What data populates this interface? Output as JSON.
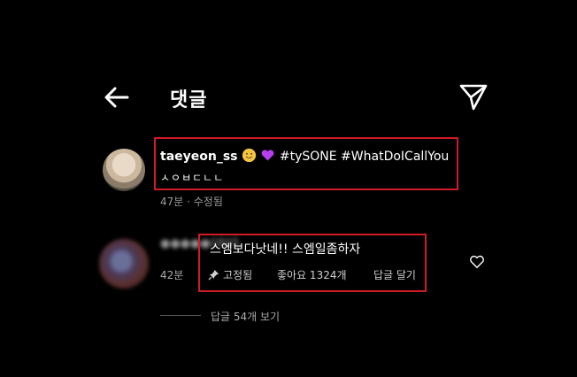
{
  "header": {
    "title": "댓글",
    "back_icon": "back-arrow-icon",
    "send_icon": "send-icon"
  },
  "caption": {
    "username": "taeyeon_ss",
    "emojis": [
      "slightly-smiling-face",
      "purple-heart"
    ],
    "text": " #tySONE #WhatDoICallYou",
    "line2": "ㅅㅇㅂㄷㄴㄴ",
    "meta": "47분 · 수정됨"
  },
  "comment": {
    "username": "●●●●●0805",
    "text": "스엠보다낫네!! 스엠일좀하자",
    "time": "42분",
    "pinned_label": "고정됨",
    "likes_label": "좋아요 1324개",
    "reply_label": "답글 달기",
    "view_replies": "답글 54개 보기"
  },
  "colors": {
    "highlight_border": "#d01c27",
    "background": "#000000",
    "muted_text": "#9b9b9b"
  }
}
